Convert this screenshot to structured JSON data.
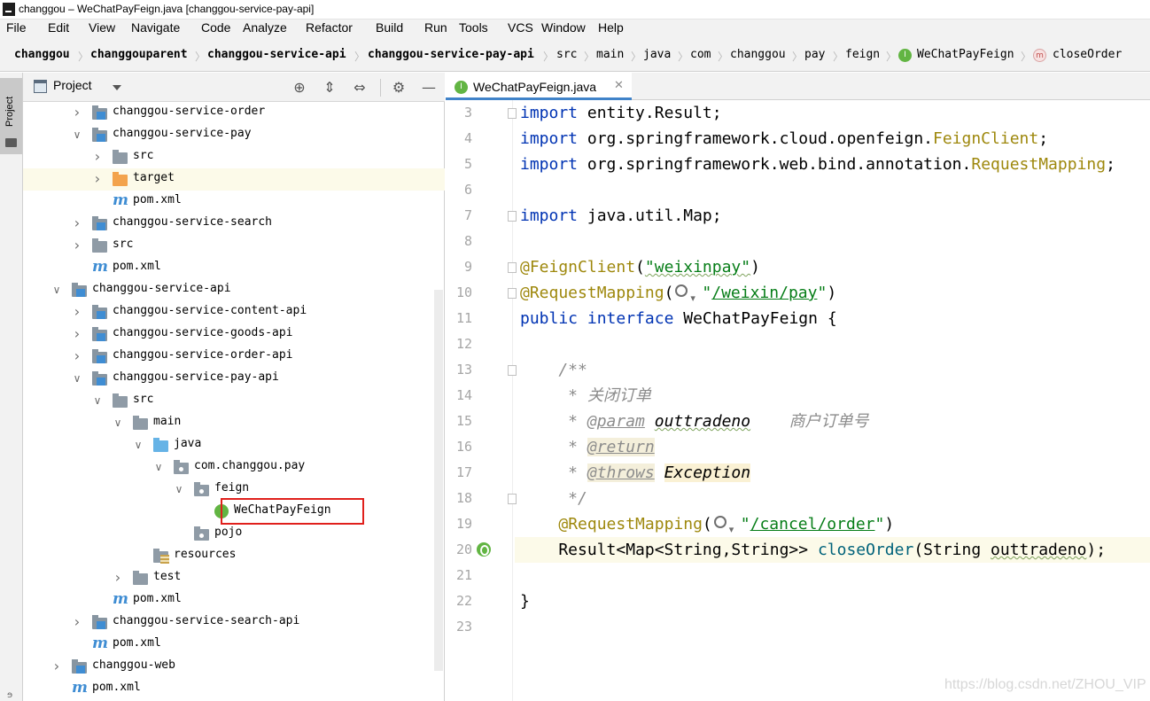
{
  "window": {
    "title": "changgou – WeChatPayFeign.java [changgou-service-pay-api]"
  },
  "menu": [
    "File",
    "Edit",
    "View",
    "Navigate",
    "Code",
    "Analyze",
    "Refactor",
    "Build",
    "Run",
    "Tools",
    "VCS",
    "Window",
    "Help"
  ],
  "breadcrumb": [
    "changgou",
    "changgouparent",
    "changgou-service-api",
    "changgou-service-pay-api",
    "src",
    "main",
    "java",
    "com",
    "changgou",
    "pay",
    "feign",
    "WeChatPayFeign",
    "closeOrder"
  ],
  "project_panel": {
    "title": "Project",
    "side_tab_label": "Project",
    "tree": [
      {
        "label": "changgou-service-order",
        "icon": "module-icon",
        "arrow": "▶"
      },
      {
        "label": "changgou-service-pay",
        "icon": "module-icon",
        "arrow": "▼"
      },
      {
        "label": "src",
        "icon": "folder-icon",
        "arrow": "▶"
      },
      {
        "label": "target",
        "icon": "folder-orange-icon",
        "arrow": "▶"
      },
      {
        "label": "pom.xml",
        "icon": "maven-icon",
        "arrow": ""
      },
      {
        "label": "changgou-service-search",
        "icon": "module-icon",
        "arrow": "▶"
      },
      {
        "label": "src",
        "icon": "folder-icon",
        "arrow": "▶"
      },
      {
        "label": "pom.xml",
        "icon": "maven-icon",
        "arrow": ""
      },
      {
        "label": "changgou-service-api",
        "icon": "module-icon",
        "arrow": "▼"
      },
      {
        "label": "changgou-service-content-api",
        "icon": "module-icon",
        "arrow": "▶"
      },
      {
        "label": "changgou-service-goods-api",
        "icon": "module-icon",
        "arrow": "▶"
      },
      {
        "label": "changgou-service-order-api",
        "icon": "module-icon",
        "arrow": "▶"
      },
      {
        "label": "changgou-service-pay-api",
        "icon": "module-icon",
        "arrow": "▼"
      },
      {
        "label": "src",
        "icon": "folder-icon",
        "arrow": "▼"
      },
      {
        "label": "main",
        "icon": "folder-icon",
        "arrow": "▼"
      },
      {
        "label": "java",
        "icon": "folder-blue-icon",
        "arrow": "▼"
      },
      {
        "label": "com.changgou.pay",
        "icon": "package-icon",
        "arrow": "▼"
      },
      {
        "label": "feign",
        "icon": "package-icon",
        "arrow": "▼"
      },
      {
        "label": "WeChatPayFeign",
        "icon": "interface-icon",
        "arrow": ""
      },
      {
        "label": "pojo",
        "icon": "package-icon",
        "arrow": ""
      },
      {
        "label": "resources",
        "icon": "resources-icon",
        "arrow": ""
      },
      {
        "label": "test",
        "icon": "folder-icon",
        "arrow": "▶"
      },
      {
        "label": "pom.xml",
        "icon": "maven-icon",
        "arrow": ""
      },
      {
        "label": "changgou-service-search-api",
        "icon": "module-icon",
        "arrow": "▶"
      },
      {
        "label": "pom.xml",
        "icon": "maven-icon",
        "arrow": ""
      },
      {
        "label": "changgou-web",
        "icon": "module-icon",
        "arrow": "▶"
      },
      {
        "label": "pom.xml",
        "icon": "maven-icon",
        "arrow": ""
      }
    ]
  },
  "editor": {
    "tab_label": "WeChatPayFeign.java",
    "line_numbers": [
      "3",
      "4",
      "5",
      "6",
      "7",
      "8",
      "9",
      "10",
      "11",
      "12",
      "13",
      "14",
      "15",
      "16",
      "17",
      "18",
      "19",
      "20",
      "21",
      "22",
      "23"
    ],
    "code": {
      "l3_kw": "import",
      "l3_rest": " entity.Result;",
      "l4_kw": "import",
      "l4_rest": " org.springframework.cloud.openfeign.",
      "l4_cls": "FeignClient",
      "l4_end": ";",
      "l5_kw": "import",
      "l5_rest": " org.springframework.web.bind.annotation.",
      "l5_cls": "RequestMapping",
      "l5_end": ";",
      "l7_kw": "import",
      "l7_rest": " java.util.Map;",
      "l9_ann": "@FeignClient",
      "l9_open": "(",
      "l9_str": "\"weixinpay\"",
      "l9_close": ")",
      "l10_ann": "@RequestMapping",
      "l10_open": "(",
      "l10_q": "\"",
      "l10_str": "/weixin/pay",
      "l10_q2": "\"",
      "l10_close": ")",
      "l11_kw1": "public",
      "l11_kw2": "interface",
      "l11_rest": " WeChatPayFeign {",
      "l13_cmt": "    /**",
      "l14_cmt": "     * 关闭订单",
      "l15_pre": "     * ",
      "l15_tag": "@param",
      "l15_sp": " ",
      "l15_arg": "outtradeno",
      "l15_desc": "    商户订单号",
      "l16_pre": "     * ",
      "l16_tag": "@return",
      "l17_pre": "     * ",
      "l17_tag": "@throws",
      "l17_sp": " ",
      "l17_exc": "Exception",
      "l18_cmt": "     */",
      "l19_pre": "    ",
      "l19_ann": "@RequestMapping",
      "l19_open": "(",
      "l19_q": "\"",
      "l19_str": "/cancel/order",
      "l19_q2": "\"",
      "l19_close": ")",
      "l20_pre": "    Result<Map<String,String>> ",
      "l20_method": "closeOrder",
      "l20_mid": "(String ",
      "l20_arg": "outtradeno",
      "l20_end": ");",
      "l22": "}"
    }
  },
  "watermark": "https://blog.csdn.net/ZHOU_VIP",
  "colors": {
    "keyword": "#0033b3",
    "annotation": "#9e880d",
    "string": "#067d17",
    "comment": "#8c8c8c",
    "method": "#00627a",
    "selection_box": "#e0201c",
    "current_line": "#fcfae9"
  }
}
